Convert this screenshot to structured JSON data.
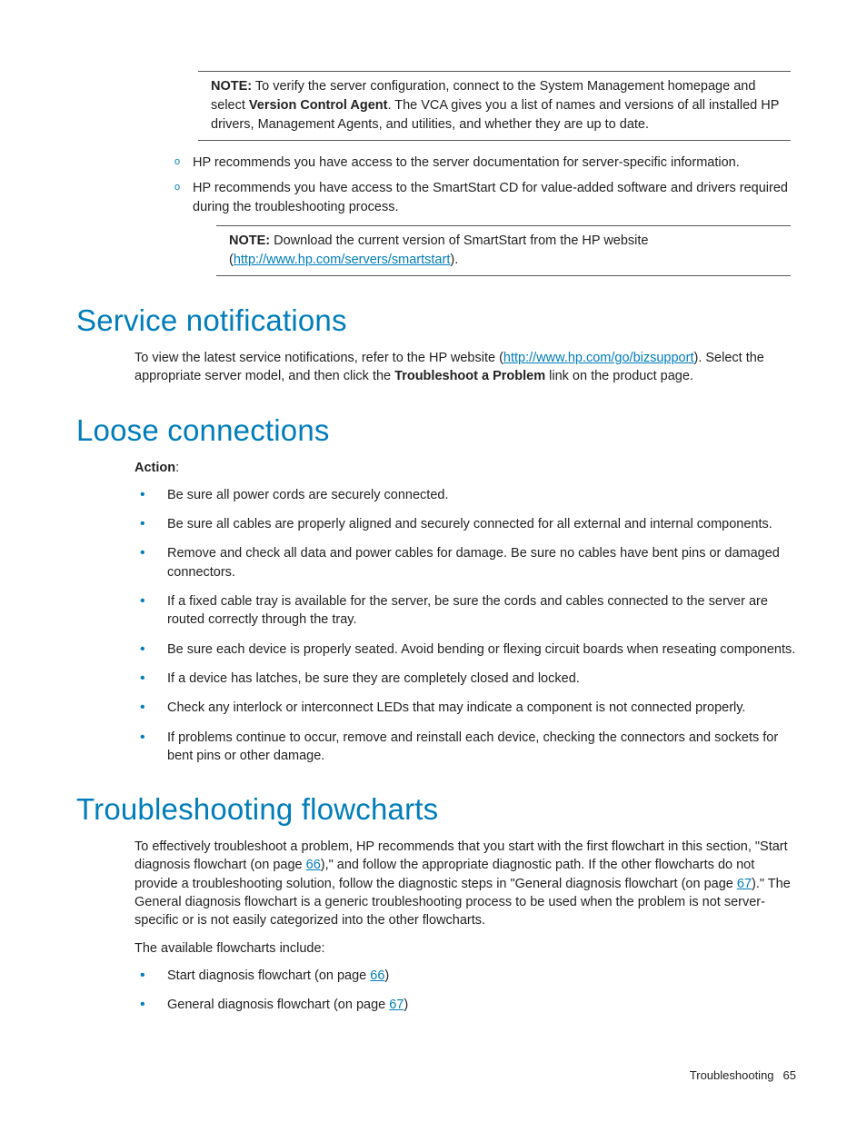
{
  "top_note": {
    "prefix": "NOTE:",
    "part1": "  To verify the server configuration, connect to the System Management homepage and select ",
    "bold1": "Version Control Agent",
    "part2": ". The VCA gives you a list of names and versions of all installed HP drivers, Management Agents, and utilities, and whether they are up to date."
  },
  "circ_items": {
    "i0": "HP recommends you have access to the server documentation for server-specific information.",
    "i1": "HP recommends you have access to the SmartStart CD for value-added software and drivers required during the troubleshooting process."
  },
  "inner_note": {
    "prefix": "NOTE:",
    "part1": "  Download the current version of SmartStart from the HP website (",
    "link": "http://www.hp.com/servers/smartstart",
    "part2": ")."
  },
  "service": {
    "heading": "Service notifications",
    "p1a": "To view the latest service notifications, refer to the HP website (",
    "p1link": "http://www.hp.com/go/bizsupport",
    "p1b": "). Select the appropriate server model, and then click the ",
    "p1bold": "Troubleshoot a Problem",
    "p1c": " link on the product page."
  },
  "loose": {
    "heading": "Loose connections",
    "action_label": "Action",
    "action_colon": ":",
    "items": {
      "i0": "Be sure all power cords are securely connected.",
      "i1": "Be sure all cables are properly aligned and securely connected for all external and internal components.",
      "i2": "Remove and check all data and power cables for damage. Be sure no cables have bent pins or damaged connectors.",
      "i3": "If a fixed cable tray is available for the server, be sure the cords and cables connected to the server are routed correctly through the tray.",
      "i4": "Be sure each device is properly seated. Avoid bending or flexing circuit boards when reseating components.",
      "i5": "If a device has latches, be sure they are completely closed and locked.",
      "i6": "Check any interlock or interconnect LEDs that may indicate a component is not connected properly.",
      "i7": "If problems continue to occur, remove and reinstall each device, checking the connectors and sockets for bent pins or other damage."
    }
  },
  "flow": {
    "heading": "Troubleshooting flowcharts",
    "p1a": "To effectively troubleshoot a problem, HP recommends that you start with the first flowchart in this section, \"Start diagnosis flowchart (on page ",
    "p1ref1": "66",
    "p1b": "),\" and follow the appropriate diagnostic path. If the other flowcharts do not provide a troubleshooting solution, follow the diagnostic steps in \"General diagnosis flowchart (on page ",
    "p1ref2": "67",
    "p1c": ").\" The General diagnosis flowchart is a generic troubleshooting process to be used when the problem is not server-specific or is not easily categorized into the other flowcharts.",
    "p2": "The available flowcharts include:",
    "items": {
      "i0a": "Start diagnosis flowchart (on page ",
      "i0ref": "66",
      "i0b": ")",
      "i1a": "General diagnosis flowchart (on page ",
      "i1ref": "67",
      "i1b": ")"
    }
  },
  "footer": {
    "section": "Troubleshooting",
    "page": "65"
  }
}
